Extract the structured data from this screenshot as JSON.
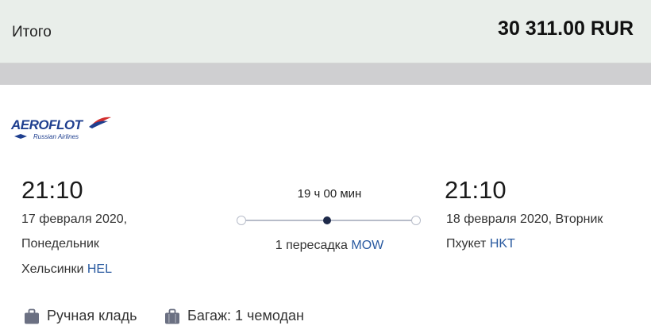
{
  "total": {
    "label": "Итого",
    "amount": "30 311.00 RUR"
  },
  "airline": {
    "name": "AEROFLOT",
    "sub": "Russian Airlines"
  },
  "departure": {
    "time": "21:10",
    "date_line1": "17 февраля 2020,",
    "date_line2": "Понедельник",
    "city": "Хельсинки",
    "code": "HEL"
  },
  "route": {
    "duration": "19 ч 00 мин",
    "transfer_text": "1 пересадка",
    "transfer_code": "MOW"
  },
  "arrival": {
    "time": "21:10",
    "date_line1": "18 февраля 2020, Вторник",
    "city": "Пхукет",
    "code": "HKT"
  },
  "baggage": {
    "carry_on": "Ручная кладь",
    "checked": "Багаж: 1 чемодан"
  },
  "colors": {
    "accent_code": "#2a5aa0",
    "logo_blue": "#1f3f8f",
    "logo_red": "#d32f2f"
  }
}
